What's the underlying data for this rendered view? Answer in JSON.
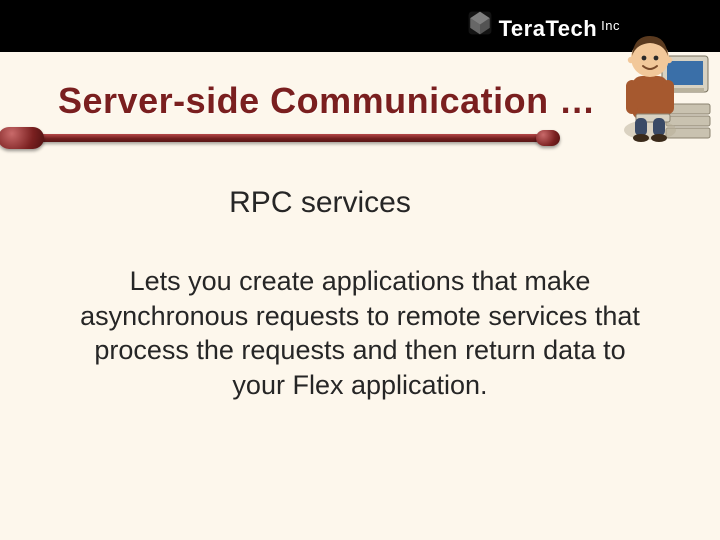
{
  "logo": {
    "brand_a": "Tera",
    "brand_b": "Tech",
    "suffix": "Inc"
  },
  "title": "Server-side Communication …",
  "subheading": "RPC services",
  "body": "Lets you create applications that make asynchronous requests to remote services that process the requests and then return data to your Flex application.",
  "colors": {
    "accent": "#7a1f1f",
    "bg": "#fdf7ec"
  }
}
